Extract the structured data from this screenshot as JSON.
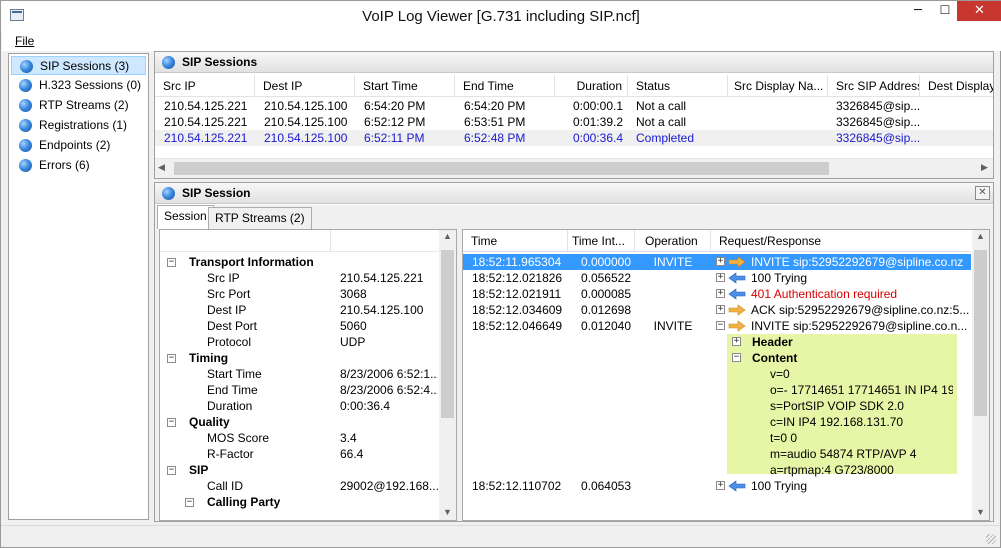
{
  "window": {
    "title": "VoIP Log Viewer [G.731 including SIP.ncf]",
    "minimize": "─",
    "maximize": "☐",
    "close": "✕"
  },
  "menu": {
    "file": "File"
  },
  "nav": {
    "items": [
      {
        "label": "SIP Sessions (3)"
      },
      {
        "label": "H.323 Sessions (0)"
      },
      {
        "label": "RTP Streams (2)"
      },
      {
        "label": "Registrations (1)"
      },
      {
        "label": "Endpoints (2)"
      },
      {
        "label": "Errors (6)"
      }
    ]
  },
  "sessions": {
    "title": "SIP Sessions",
    "columns": [
      "Src IP",
      "Dest IP",
      "Start Time",
      "End Time",
      "Duration",
      "Status",
      "Src Display Na...",
      "Src SIP Address",
      "Dest Display"
    ],
    "rows": [
      [
        "210.54.125.221",
        "210.54.125.100",
        "6:54:20 PM",
        "6:54:20 PM",
        "0:00:00.1",
        "Not a call",
        "",
        "3326845@sip..."
      ],
      [
        "210.54.125.221",
        "210.54.125.100",
        "6:52:12 PM",
        "6:53:51 PM",
        "0:01:39.2",
        "Not a call",
        "",
        "3326845@sip..."
      ],
      [
        "210.54.125.221",
        "210.54.125.100",
        "6:52:11 PM",
        "6:52:48 PM",
        "0:00:36.4",
        "Completed",
        "",
        "3326845@sip..."
      ]
    ]
  },
  "session": {
    "title": "SIP Session",
    "close": "✕",
    "tabs": [
      "Session",
      "RTP Streams (2)"
    ],
    "tree": [
      {
        "label": "Transport Information",
        "value": "",
        "level": 0
      },
      {
        "label": "Src IP",
        "value": "210.54.125.221",
        "level": 1
      },
      {
        "label": "Src Port",
        "value": "3068",
        "level": 1
      },
      {
        "label": "Dest IP",
        "value": "210.54.125.100",
        "level": 1
      },
      {
        "label": "Dest Port",
        "value": "5060",
        "level": 1
      },
      {
        "label": "Protocol",
        "value": "UDP",
        "level": 1
      },
      {
        "label": "Timing",
        "value": "",
        "level": 0
      },
      {
        "label": "Start Time",
        "value": "8/23/2006 6:52:1...",
        "level": 1
      },
      {
        "label": "End Time",
        "value": "8/23/2006 6:52:4...",
        "level": 1
      },
      {
        "label": "Duration",
        "value": "0:00:36.4",
        "level": 1
      },
      {
        "label": "Quality",
        "value": "",
        "level": 0
      },
      {
        "label": "MOS Score",
        "value": "3.4",
        "level": 1
      },
      {
        "label": "R-Factor",
        "value": "66.4",
        "level": 1
      },
      {
        "label": "SIP",
        "value": "",
        "level": 0
      },
      {
        "label": "Call ID",
        "value": "29002@192.168....",
        "level": 1
      },
      {
        "label": "Calling Party",
        "value": "",
        "level": 1
      }
    ],
    "msg_columns": [
      "Time",
      "Time Int...",
      "Operation",
      "Request/Response"
    ],
    "messages": [
      {
        "time": "18:52:11.965304",
        "interval": "0.000000",
        "op": "INVITE",
        "text": "INVITE sip:52952292679@sipline.co.nz"
      },
      {
        "time": "18:52:12.021826",
        "interval": "0.056522",
        "op": "",
        "text": "100 Trying"
      },
      {
        "time": "18:52:12.021911",
        "interval": "0.000085",
        "op": "",
        "text": "401 Authentication required"
      },
      {
        "time": "18:52:12.034609",
        "interval": "0.012698",
        "op": "",
        "text": "ACK sip:52952292679@sipline.co.nz:5..."
      },
      {
        "time": "18:52:12.046649",
        "interval": "0.012040",
        "op": "INVITE",
        "text": "INVITE sip:52952292679@sipline.co.n..."
      }
    ],
    "detail": {
      "header": "Header",
      "content": "Content",
      "lines": [
        "v=0",
        "o=- 17714651 17714651 IN IP4 19...",
        "s=PortSIP VOIP SDK 2.0",
        "c=IN IP4 192.168.131.70",
        "t=0 0",
        "m=audio 54874 RTP/AVP 4",
        "a=rtpmap:4 G723/8000"
      ]
    },
    "last": {
      "time": "18:52:12.110702",
      "interval": "0.064053",
      "text": "100 Trying"
    }
  },
  "colors": {
    "selection": "#cde8ff",
    "link_blue": "#1a1ad0",
    "error_red": "#d80000",
    "content_bg": "#e6f5a6"
  }
}
